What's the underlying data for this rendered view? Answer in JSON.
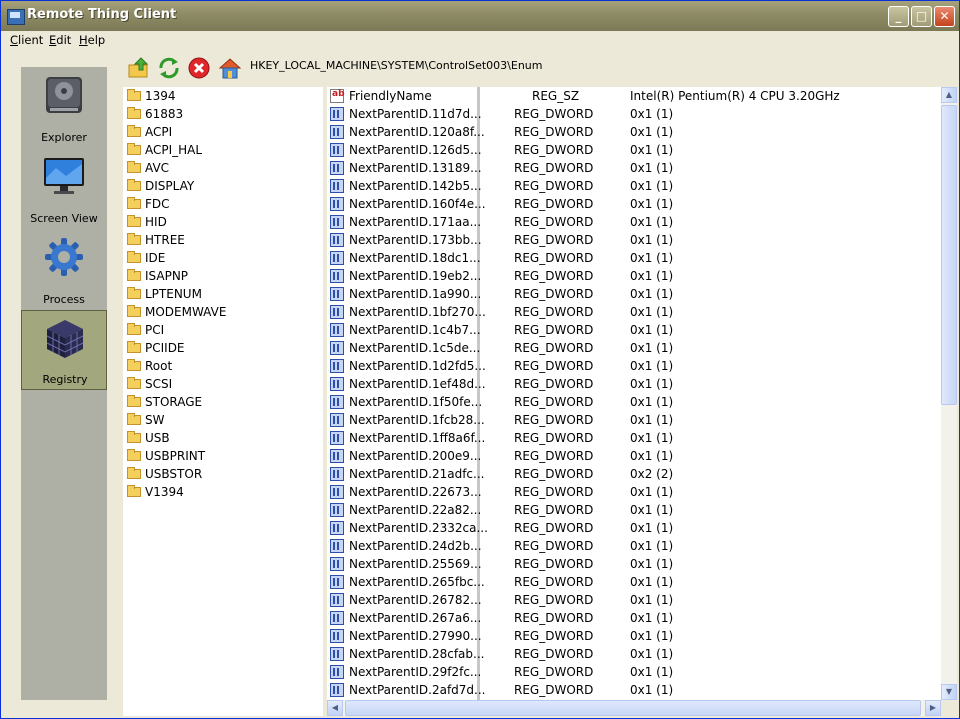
{
  "window": {
    "title": "Remote Thing Client"
  },
  "titlebar_buttons": {
    "minimize": "_",
    "maximize": "□",
    "close": "✕"
  },
  "menu": [
    "Client",
    "Edit",
    "Help"
  ],
  "sidebar": {
    "items": [
      {
        "label": "Explorer",
        "icon": "drive-icon"
      },
      {
        "label": "Screen View",
        "icon": "monitor-icon"
      },
      {
        "label": "Process",
        "icon": "gear-icon"
      },
      {
        "label": "Registry",
        "icon": "registry-cube-icon",
        "active": true
      }
    ]
  },
  "toolbar": {
    "path": "HKEY_LOCAL_MACHINE\\SYSTEM\\ControlSet003\\Enum",
    "tools": [
      "up-folder-icon",
      "refresh-icon",
      "stop-icon",
      "home-icon"
    ]
  },
  "tree": {
    "items": [
      "1394",
      "61883",
      "ACPI",
      "ACPI_HAL",
      "AVC",
      "DISPLAY",
      "FDC",
      "HID",
      "HTREE",
      "IDE",
      "ISAPNP",
      "LPTENUM",
      "MODEMWAVE",
      "PCI",
      "PCIIDE",
      "Root",
      "SCSI",
      "STORAGE",
      "SW",
      "USB",
      "USBPRINT",
      "USBSTOR",
      "V1394"
    ]
  },
  "values": {
    "rows": [
      {
        "name": "FriendlyName",
        "type": "REG_SZ",
        "value": "Intel(R) Pentium(R) 4 CPU 3.20GHz"
      },
      {
        "name": "NextParentID.11d7d...",
        "type": "REG_DWORD",
        "value": "0x1 (1)"
      },
      {
        "name": "NextParentID.120a8f...",
        "type": "REG_DWORD",
        "value": "0x1 (1)"
      },
      {
        "name": "NextParentID.126d5...",
        "type": "REG_DWORD",
        "value": "0x1 (1)"
      },
      {
        "name": "NextParentID.13189...",
        "type": "REG_DWORD",
        "value": "0x1 (1)"
      },
      {
        "name": "NextParentID.142b5...",
        "type": "REG_DWORD",
        "value": "0x1 (1)"
      },
      {
        "name": "NextParentID.160f4e...",
        "type": "REG_DWORD",
        "value": "0x1 (1)"
      },
      {
        "name": "NextParentID.171aa...",
        "type": "REG_DWORD",
        "value": "0x1 (1)"
      },
      {
        "name": "NextParentID.173bb...",
        "type": "REG_DWORD",
        "value": "0x1 (1)"
      },
      {
        "name": "NextParentID.18dc1...",
        "type": "REG_DWORD",
        "value": "0x1 (1)"
      },
      {
        "name": "NextParentID.19eb2...",
        "type": "REG_DWORD",
        "value": "0x1 (1)"
      },
      {
        "name": "NextParentID.1a990...",
        "type": "REG_DWORD",
        "value": "0x1 (1)"
      },
      {
        "name": "NextParentID.1bf270...",
        "type": "REG_DWORD",
        "value": "0x1 (1)"
      },
      {
        "name": "NextParentID.1c4b7...",
        "type": "REG_DWORD",
        "value": "0x1 (1)"
      },
      {
        "name": "NextParentID.1c5de...",
        "type": "REG_DWORD",
        "value": "0x1 (1)"
      },
      {
        "name": "NextParentID.1d2fd5...",
        "type": "REG_DWORD",
        "value": "0x1 (1)"
      },
      {
        "name": "NextParentID.1ef48d...",
        "type": "REG_DWORD",
        "value": "0x1 (1)"
      },
      {
        "name": "NextParentID.1f50fe...",
        "type": "REG_DWORD",
        "value": "0x1 (1)"
      },
      {
        "name": "NextParentID.1fcb28...",
        "type": "REG_DWORD",
        "value": "0x1 (1)"
      },
      {
        "name": "NextParentID.1ff8a6f...",
        "type": "REG_DWORD",
        "value": "0x1 (1)"
      },
      {
        "name": "NextParentID.200e9...",
        "type": "REG_DWORD",
        "value": "0x1 (1)"
      },
      {
        "name": "NextParentID.21adfc...",
        "type": "REG_DWORD",
        "value": "0x2 (2)"
      },
      {
        "name": "NextParentID.22673...",
        "type": "REG_DWORD",
        "value": "0x1 (1)"
      },
      {
        "name": "NextParentID.22a82...",
        "type": "REG_DWORD",
        "value": "0x1 (1)"
      },
      {
        "name": "NextParentID.2332ca...",
        "type": "REG_DWORD",
        "value": "0x1 (1)"
      },
      {
        "name": "NextParentID.24d2b...",
        "type": "REG_DWORD",
        "value": "0x1 (1)"
      },
      {
        "name": "NextParentID.25569...",
        "type": "REG_DWORD",
        "value": "0x1 (1)"
      },
      {
        "name": "NextParentID.265fbc...",
        "type": "REG_DWORD",
        "value": "0x1 (1)"
      },
      {
        "name": "NextParentID.26782...",
        "type": "REG_DWORD",
        "value": "0x1 (1)"
      },
      {
        "name": "NextParentID.267a6...",
        "type": "REG_DWORD",
        "value": "0x1 (1)"
      },
      {
        "name": "NextParentID.27990...",
        "type": "REG_DWORD",
        "value": "0x1 (1)"
      },
      {
        "name": "NextParentID.28cfab...",
        "type": "REG_DWORD",
        "value": "0x1 (1)"
      },
      {
        "name": "NextParentID.29f2fc...",
        "type": "REG_DWORD",
        "value": "0x1 (1)"
      },
      {
        "name": "NextParentID.2afd7d...",
        "type": "REG_DWORD",
        "value": "0x1 (1)"
      }
    ]
  }
}
